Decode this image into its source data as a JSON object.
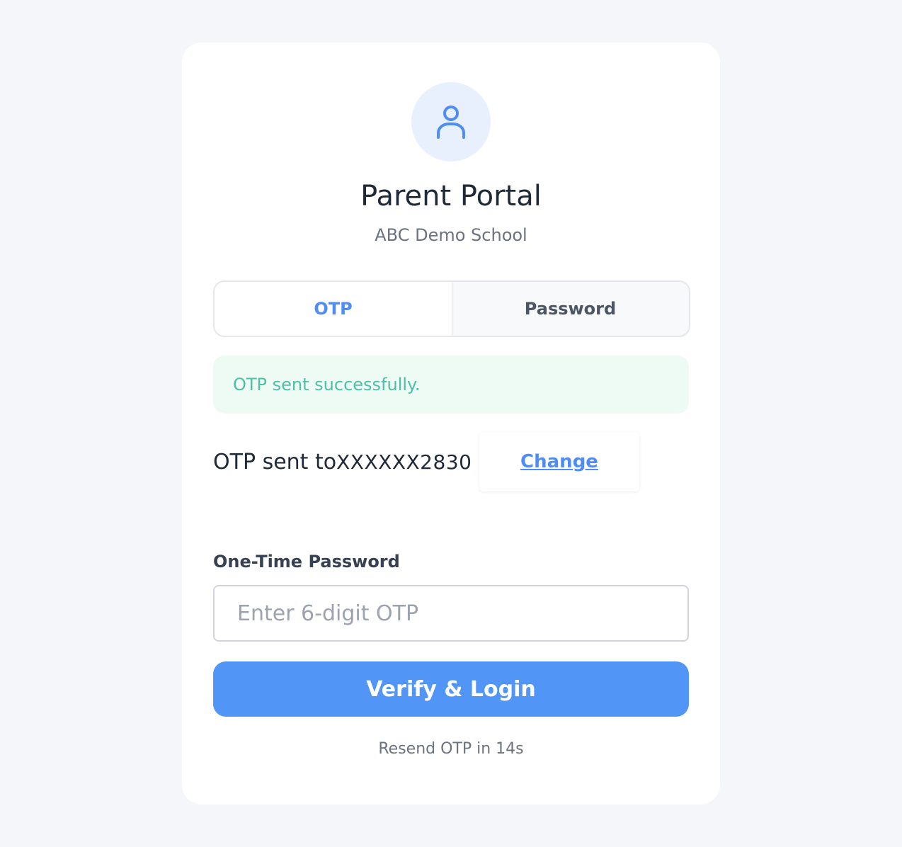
{
  "header": {
    "title": "Parent Portal",
    "subtitle": "ABC Demo School",
    "avatar_icon": "user-icon"
  },
  "tabs": [
    {
      "label": "OTP",
      "active": true
    },
    {
      "label": "Password",
      "active": false
    }
  ],
  "alert": {
    "message": "OTP sent successfully.",
    "color": "#4fbfa6"
  },
  "otp_info": {
    "prefix": "OTP sent to ",
    "number": "XXXXXX2830",
    "change_label": "Change"
  },
  "otp_field": {
    "label": "One-Time Password",
    "value": "",
    "placeholder": "Enter 6-digit OTP"
  },
  "verify_button": {
    "label": "Verify & Login",
    "color": "#5195f6"
  },
  "resend": {
    "text": "Resend OTP in 14s"
  },
  "colors": {
    "accent": "#4f8df5",
    "background": "#f4f6fa"
  }
}
